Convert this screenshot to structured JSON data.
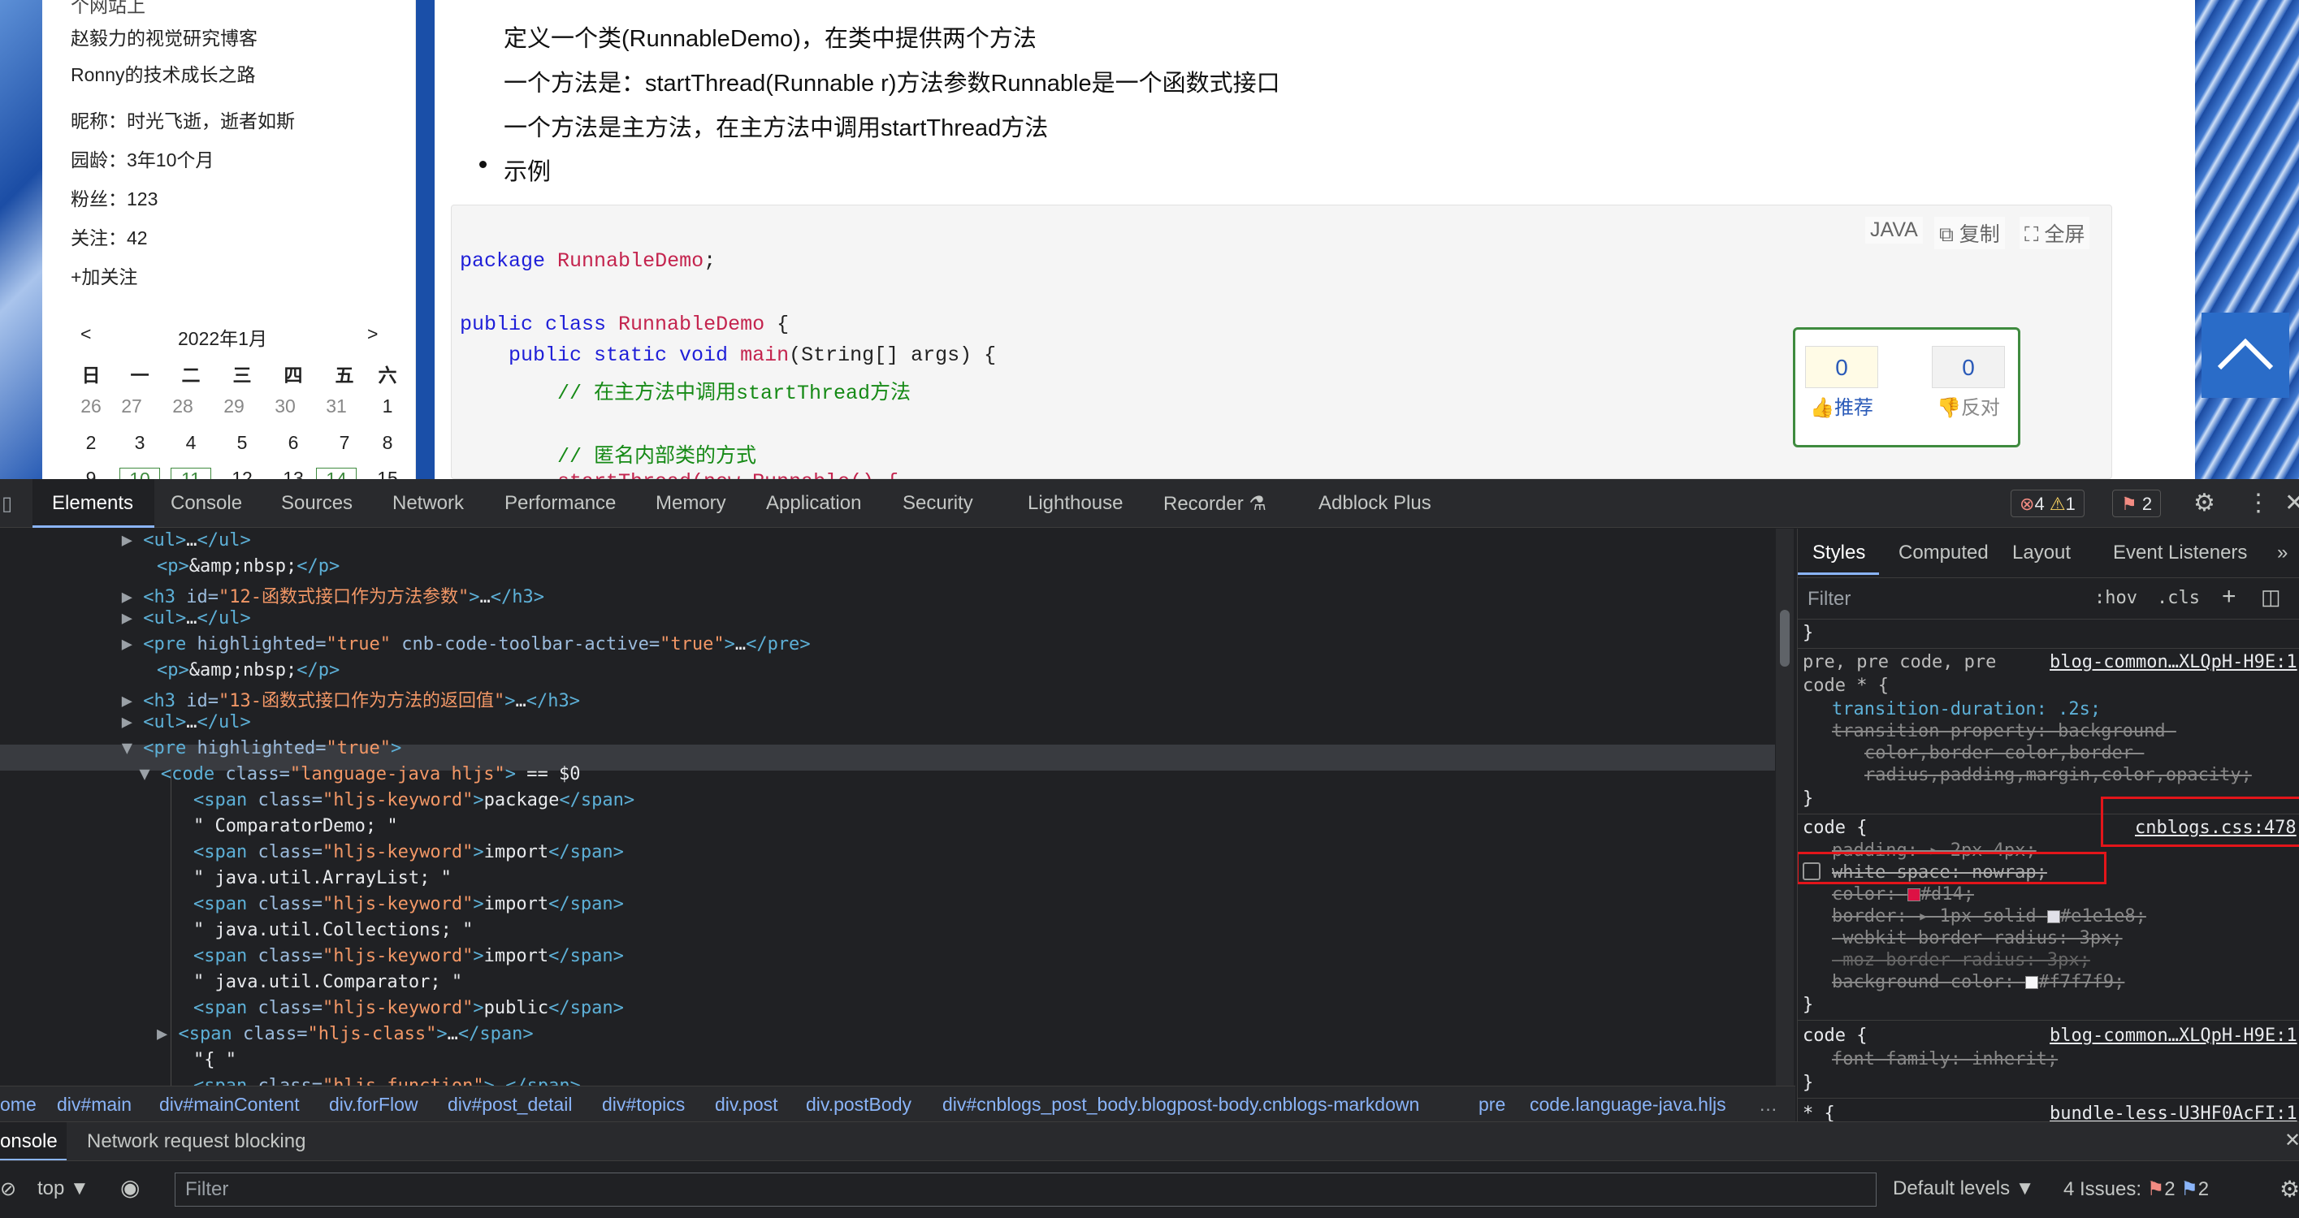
{
  "blog": {
    "sidebar": {
      "partial_top": "个网站上",
      "links": [
        "赵毅力的视觉研究博客",
        "Ronny的技术成长之路"
      ],
      "profile": [
        {
          "label": "昵称：",
          "value": "时光飞逝，逝者如斯"
        },
        {
          "label": "园龄：",
          "value": "3年10个月"
        },
        {
          "label": "粉丝：",
          "value": "123"
        },
        {
          "label": "关注：",
          "value": "42"
        }
      ],
      "follow": "+加关注",
      "calendar": {
        "prev": "<",
        "next": ">",
        "month": "2022年1月",
        "weekdays": [
          "日",
          "一",
          "二",
          "三",
          "四",
          "五",
          "六"
        ],
        "row1": [
          "26",
          "27",
          "28",
          "29",
          "30",
          "31",
          "1"
        ],
        "row2": [
          "2",
          "3",
          "4",
          "5",
          "6",
          "7",
          "8"
        ],
        "row3": [
          "9",
          "10",
          "11",
          "12",
          "13",
          "14",
          "15"
        ]
      }
    },
    "article": {
      "p1": "定义一个类(RunnableDemo)，在类中提供两个方法",
      "p2": "一个方法是：startThread(Runnable r)方法参数Runnable是一个函数式接口",
      "p3": "一个方法是主方法，在主方法中调用startThread方法",
      "bullet": "示例"
    },
    "code_toolbar": {
      "lang": "JAVA",
      "copy": "复制",
      "fullscreen": "全屏"
    },
    "code": {
      "l1_kw": "package",
      "l1_cls": "RunnableDemo",
      "l1_end": ";",
      "l2_kw": "public class",
      "l2_cls": "RunnableDemo",
      "l2_end": " {",
      "l3_kw": "    public static void",
      "l3_cls": "main",
      "l3_end": "(String[] args) {",
      "l4": "        // 在主方法中调用startThread方法",
      "l5": "        // 匿名内部类的方式",
      "l6": "        startThread(new Runnable() {"
    },
    "votes": {
      "up_count": "0",
      "up_label": "推荐",
      "down_count": "0",
      "down_label": "反对"
    }
  },
  "devtools": {
    "tabs": [
      "Elements",
      "Console",
      "Sources",
      "Network",
      "Performance",
      "Memory",
      "Application",
      "Security",
      "Lighthouse",
      "Recorder ⚗",
      "Adblock Plus"
    ],
    "errors": "4",
    "warnings": "1",
    "issues": "2",
    "dom_lines": [
      {
        "indent": 100,
        "tri": "▶",
        "html": "<ul>…</ul>"
      },
      {
        "indent": 110,
        "tri": "",
        "html": "<p>&amp;nbsp;</p>"
      },
      {
        "indent": 100,
        "tri": "▶",
        "html": "<h3 id=\"12-函数式接口作为方法参数\">…</h3>"
      },
      {
        "indent": 100,
        "tri": "▶",
        "html": "<ul>…</ul>"
      },
      {
        "indent": 100,
        "tri": "▶",
        "html": "<pre highlighted=\"true\" cnb-code-toolbar-active=\"true\">…</pre>"
      },
      {
        "indent": 110,
        "tri": "",
        "html": "<p>&amp;nbsp;</p>"
      },
      {
        "indent": 100,
        "tri": "▶",
        "html": "<h3 id=\"13-函数式接口作为方法的返回值\">…</h3>"
      },
      {
        "indent": 100,
        "tri": "▶",
        "html": "<ul>…</ul>"
      },
      {
        "indent": 100,
        "tri": "▼",
        "html": "<pre highlighted=\"true\">"
      },
      {
        "indent": 112,
        "tri": "▼",
        "html": "<code class=\"language-java hljs\"> == $0"
      },
      {
        "indent": 135,
        "tri": "",
        "html": "<span class=\"hljs-keyword\">package</span>"
      },
      {
        "indent": 135,
        "tri": "",
        "html": "\" ComparatorDemo; \""
      },
      {
        "indent": 135,
        "tri": "",
        "html": "<span class=\"hljs-keyword\">import</span>"
      },
      {
        "indent": 135,
        "tri": "",
        "html": "\" java.util.ArrayList; \""
      },
      {
        "indent": 135,
        "tri": "",
        "html": "<span class=\"hljs-keyword\">import</span>"
      },
      {
        "indent": 135,
        "tri": "",
        "html": "\" java.util.Collections; \""
      },
      {
        "indent": 135,
        "tri": "",
        "html": "<span class=\"hljs-keyword\">import</span>"
      },
      {
        "indent": 135,
        "tri": "",
        "html": "\" java.util.Comparator; \""
      },
      {
        "indent": 135,
        "tri": "",
        "html": "<span class=\"hljs-keyword\">public</span>"
      },
      {
        "indent": 124,
        "tri": "▶",
        "html": "<span class=\"hljs-class\">…</span>"
      },
      {
        "indent": 135,
        "tri": "",
        "html": "\"{ \""
      },
      {
        "indent": 135,
        "tri": "",
        "html": "<span class=\"hljs-function\">…</span>"
      }
    ],
    "breadcrumbs": [
      "ome",
      "div#main",
      "div#mainContent",
      "div.forFlow",
      "div#post_detail",
      "div#topics",
      "div.post",
      "div.postBody",
      "div#cnblogs_post_body.blogpost-body.cnblogs-markdown",
      "pre",
      "code.language-java.hljs",
      "…"
    ],
    "styles": {
      "tabs": [
        "Styles",
        "Computed",
        "Layout",
        "Event Listeners",
        "»"
      ],
      "filter_placeholder": "Filter",
      "hov": ":hov",
      "cls": ".cls",
      "rule0_close": "}",
      "rule1_selector_a": "pre, pre code, pre",
      "rule1_selector_b": "code * {",
      "rule1_src": "blog-common…XLQpH-H9E:1",
      "rule1_p1": "transition-duration: .2s;",
      "rule1_p2": "transition-property: background-",
      "rule1_p3": "color,border-color,border-",
      "rule1_p4": "radius,padding,margin,color,opacity;",
      "rule2_selector": "code {",
      "rule2_src": "cnblogs.css:478",
      "rule2_p1": "padding: ▸ 2px 4px;",
      "rule2_p2": "white-space: nowrap;",
      "rule2_p3": "color: ",
      "rule2_p3v": "#d14;",
      "rule2_p4": "border: ▸ 1px solid ",
      "rule2_p4v": "#e1e1e8;",
      "rule2_p5": "-webkit-border-radius: 3px;",
      "rule2_p6": "-moz-border-radius: 3px;",
      "rule2_p7": "background-color: ",
      "rule2_p7v": "#f7f7f9;",
      "rule3_selector": "code {",
      "rule3_src": "blog-common…XLQpH-H9E:1",
      "rule3_p1": "font-family: inherit;",
      "rule4_partial": "* {",
      "rule4_src": "bundle-less-U3HF0AcFI:1"
    },
    "drawer": {
      "console_tab": "onsole",
      "network_blocking": "Network request blocking"
    },
    "console": {
      "context": "top ▼",
      "filter_placeholder": "Filter",
      "levels": "Default levels ▼",
      "issues_label": "4 Issues:",
      "issues_red": "2",
      "issues_blue": "2"
    },
    "colors": {
      "accent": "#8ab4f8",
      "error": "#f28b82",
      "warning": "#fdd663",
      "swatch_color": "#d14",
      "swatch_border": "#e1e1e8",
      "swatch_bg": "#f7f7f9",
      "highlight_box": "#e3151a"
    }
  }
}
